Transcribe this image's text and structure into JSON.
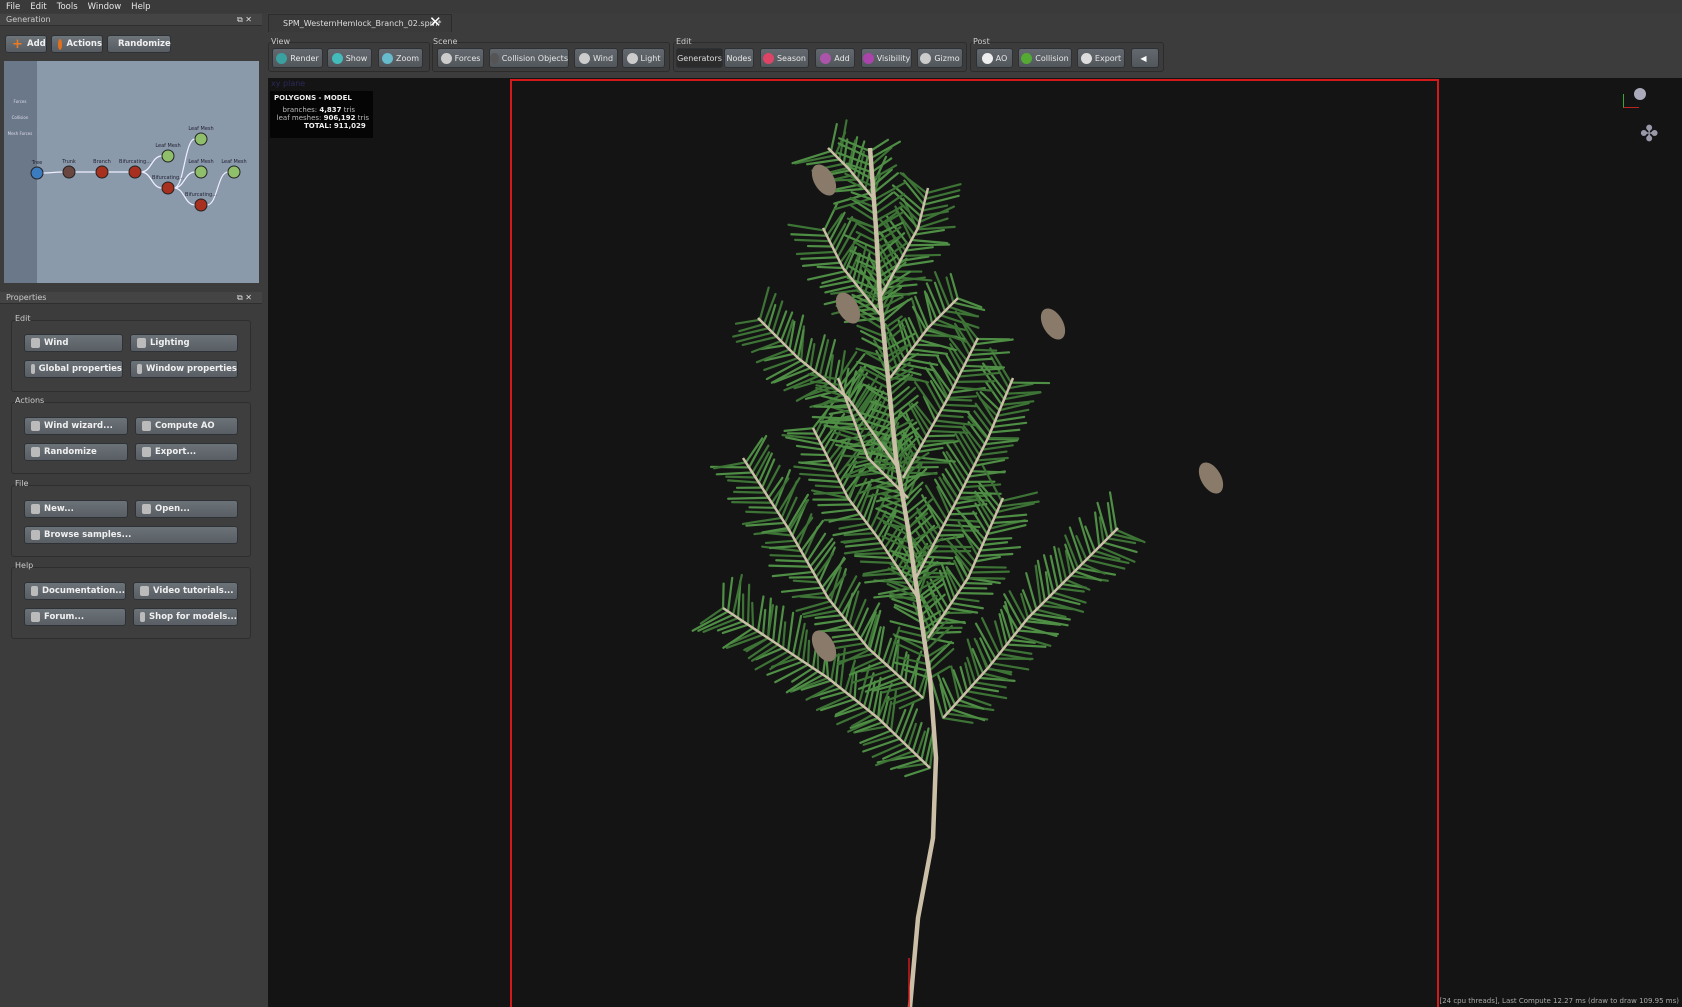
{
  "menu": [
    "File",
    "Edit",
    "Tools",
    "Window",
    "Help"
  ],
  "generation": {
    "title": "Generation",
    "buttons": [
      "Add",
      "Actions",
      "Randomize"
    ],
    "side_tools": [
      "Forces",
      "Collision",
      "Mesh Forces"
    ],
    "nodes": [
      {
        "label": "Tree",
        "kind": "tree"
      },
      {
        "label": "Trunk",
        "kind": "trunk"
      },
      {
        "label": "Branch",
        "kind": "branch"
      },
      {
        "label": "Bifurcating...",
        "kind": "branch"
      },
      {
        "label": "Leaf Mesh",
        "kind": "leaf"
      },
      {
        "label": "Bifurcating...",
        "kind": "branch"
      },
      {
        "label": "Leaf Mesh",
        "kind": "leaf"
      },
      {
        "label": "Leaf Mesh",
        "kind": "leaf"
      },
      {
        "label": "Bifurcating...",
        "kind": "branch"
      },
      {
        "label": "Leaf Mesh",
        "kind": "leaf"
      }
    ]
  },
  "properties": {
    "title": "Properties",
    "groups": [
      {
        "label": "Edit",
        "buttons": [
          "Wind",
          "Lighting",
          "Global properties",
          "Window properties"
        ]
      },
      {
        "label": "Actions",
        "buttons": [
          "Wind wizard...",
          "Compute AO",
          "Randomize",
          "Export..."
        ]
      },
      {
        "label": "File",
        "buttons": [
          "New...",
          "Open...",
          "Browse samples..."
        ]
      },
      {
        "label": "Help",
        "buttons": [
          "Documentation...",
          "Video tutorials...",
          "Forum...",
          "Shop for models..."
        ]
      }
    ]
  },
  "tab": {
    "title": "SPM_WesternHemlock_Branch_02.spm*"
  },
  "toolbar": {
    "groups": [
      "View",
      "Scene",
      "Edit",
      "Post"
    ],
    "buttons": [
      "Render",
      "Show",
      "Zoom",
      "Forces",
      "Collision Objects",
      "Wind",
      "Light",
      "Generators",
      "Nodes",
      "Season",
      "Add",
      "Visibility",
      "Gizmo",
      "AO",
      "Collision",
      "Export",
      ""
    ]
  },
  "viewport": {
    "plane_label": "xy plane",
    "stats": {
      "title": "POLYGONS - MODEL",
      "branches_label": "branches:",
      "branches": "4,837",
      "leaf_label": "leaf meshes:",
      "leaf": "906,192",
      "unit": "tris",
      "total_label": "TOTAL:",
      "total": "911,029"
    },
    "status": "[24 cpu threads], Last Compute 12.27 ms (draw to draw 109.95 ms)",
    "colors": {
      "frame": "#d21a1a",
      "needle": "#4f8f45",
      "stem": "#cbbfa8",
      "cone": "#8a7a6a"
    }
  }
}
